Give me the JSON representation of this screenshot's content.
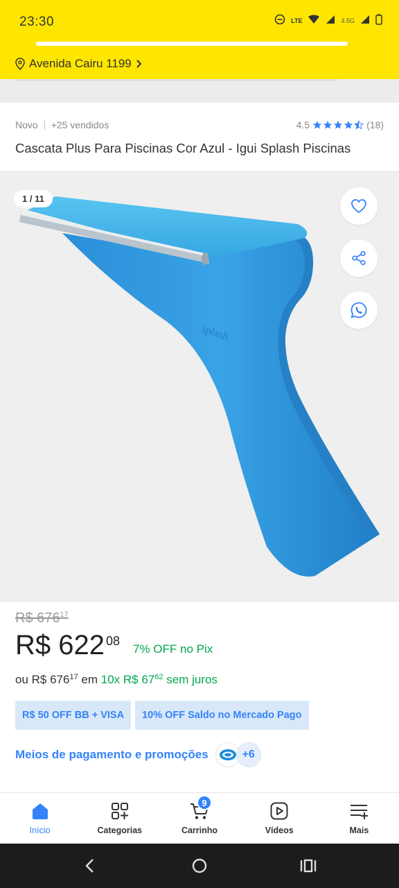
{
  "status": {
    "time": "23:30",
    "lte": "LTE",
    "signal_label": "4.5G"
  },
  "header": {
    "address": "Avenida Cairu 1199"
  },
  "product": {
    "condition": "Novo",
    "sold": "+25 vendidos",
    "rating": "4.5",
    "rating_stars": 4.5,
    "reviews": "(18)",
    "title": "Cascata Plus Para Piscinas Cor Azul - Igui Splash Piscinas"
  },
  "gallery": {
    "counter": "1 / 11"
  },
  "pricing": {
    "old_price_int": "R$ 676",
    "old_price_cents": "17",
    "price_int": "R$ 622",
    "price_cents": "08",
    "discount": "7% OFF no Pix",
    "inst_prefix": "ou R$ 676",
    "inst_prefix_cents": "17",
    "inst_mid": " em ",
    "inst_count": "10x R$ 67",
    "inst_count_cents": "62",
    "inst_suffix": " sem juros"
  },
  "promos": [
    "R$ 50 OFF BB + VISA",
    "10% OFF Saldo no Mercado Pago"
  ],
  "payment": {
    "label": "Meios de pagamento e promoções",
    "more": "+6"
  },
  "nav": [
    {
      "label": "Início",
      "icon": "home-icon"
    },
    {
      "label": "Categorias",
      "icon": "categories-icon"
    },
    {
      "label": "Carrinho",
      "icon": "cart-icon",
      "badge": "9"
    },
    {
      "label": "Vídeos",
      "icon": "video-icon"
    },
    {
      "label": "Mais",
      "icon": "menu-icon"
    }
  ],
  "colors": {
    "header": "#ffe600",
    "accent": "#3483fa",
    "green": "#00a650",
    "product_blue": "#2f9ee0"
  }
}
